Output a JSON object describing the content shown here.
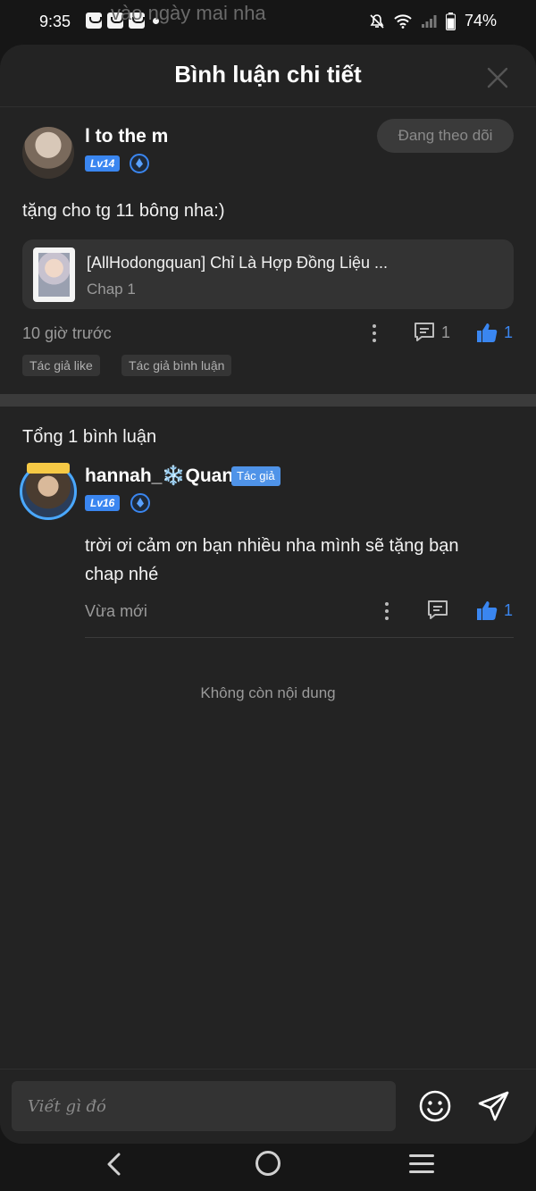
{
  "status_bar": {
    "time": "9:35",
    "battery": "74%",
    "ghost_text": "vào ngày mai nha"
  },
  "header": {
    "title": "Bình luận chi tiết"
  },
  "main_comment": {
    "username": "l to the m",
    "level": "Lv14",
    "follow_label": "Đang theo dõi",
    "text": "tặng cho tg 11 bông nha:)",
    "chapter_title": "[AllHodongquan] Chỉ Là Hợp Đồng Liệu ...",
    "chapter_sub": "Chap 1",
    "time": "10 giờ trước",
    "reply_count": "1",
    "like_count": "1",
    "tags": [
      "Tác giả like",
      "Tác giả bình luận"
    ]
  },
  "replies": {
    "total_label": "Tổng 1 bình luận",
    "items": [
      {
        "username": "hannah_❄️Quan",
        "author_tag": "Tác giả",
        "level": "Lv16",
        "text_line1": "trời ơi cảm ơn bạn nhiều nha mình sẽ tặng bạn",
        "text_line2": "chap nhé",
        "time": "Vừa mới",
        "like_count": "1"
      }
    ],
    "end_label": "Không còn nội dung"
  },
  "input": {
    "placeholder": "Viết gì đó"
  },
  "colors": {
    "accent": "#3a86f0",
    "sheet_bg": "#232323",
    "card_bg": "#333333"
  }
}
